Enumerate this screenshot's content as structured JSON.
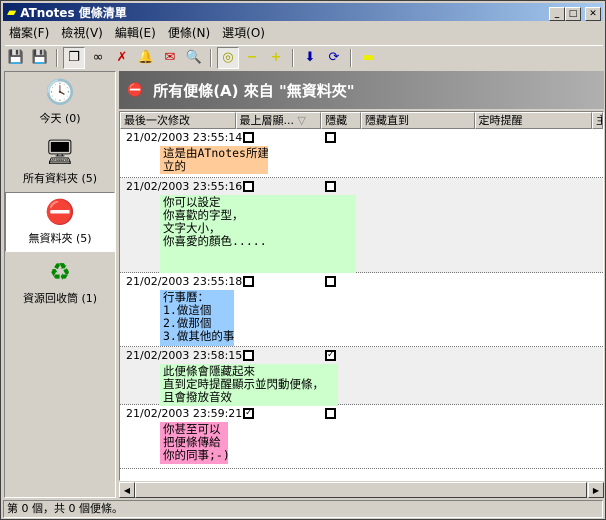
{
  "window": {
    "title": "ATnotes 便條清單"
  },
  "menu": [
    "檔案(F)",
    "檢視(V)",
    "編輯(E)",
    "便條(N)",
    "選項(O)"
  ],
  "sidebar": [
    {
      "label": "今天 (0)",
      "icon": "clock-icon"
    },
    {
      "label": "所有資料夾 (5)",
      "icon": "computer-icon"
    },
    {
      "label": "無資料夾 (5)",
      "icon": "no-entry-icon",
      "selected": true
    },
    {
      "label": "資源回收筒 (1)",
      "icon": "recycle-bin-icon"
    }
  ],
  "header": {
    "title": "所有便條(A) 來自 \"無資料夾\""
  },
  "columns": [
    "最後一次修改",
    "最上層顯...",
    "隱藏",
    "隱藏直到",
    "定時提醒",
    "主"
  ],
  "rows": [
    {
      "modified": "21/02/2003 23:55:14",
      "topmost": false,
      "hidden": false,
      "note": "這是由ATnotes所建\n立的",
      "color": "#ffcc99"
    },
    {
      "modified": "21/02/2003 23:55:16",
      "topmost": false,
      "hidden": false,
      "note": "你可以設定\n你喜歡的字型，\n文字大小，\n你喜愛的顏色.....",
      "color": "#ccffcc"
    },
    {
      "modified": "21/02/2003 23:55:18",
      "topmost": false,
      "hidden": false,
      "note": "行事曆：\n1.做這個\n2.做那個\n3.做其他的事",
      "color": "#99ccff"
    },
    {
      "modified": "21/02/2003 23:58:15",
      "topmost": false,
      "hidden": true,
      "note": "此便條會隱藏起來\n直到定時提醒顯示並閃動便條，\n且會撥放音效",
      "color": "#ccffcc"
    },
    {
      "modified": "21/02/2003 23:59:21",
      "topmost": true,
      "hidden": false,
      "note": "你甚至可以\n把便條傳給\n你的同事;-)",
      "color": "#ff99cc"
    }
  ],
  "status": "第 0 個，共 0 個便條。"
}
